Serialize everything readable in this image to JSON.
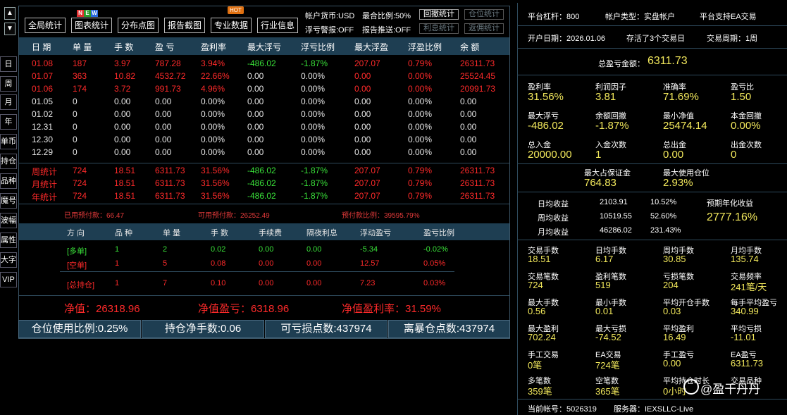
{
  "rail": {
    "up": "▲",
    "down": "▼",
    "items": [
      "日",
      "周",
      "月",
      "年",
      "单币",
      "持仓",
      "品种",
      "魔号",
      "波幅",
      "属性",
      "大字",
      "VIP"
    ]
  },
  "toolbar": {
    "buttons": [
      "全局统计",
      "图表统计",
      "分布点图",
      "报告截图",
      "专业数据",
      "行业信息"
    ],
    "new_badge": [
      "N",
      "E",
      "W"
    ],
    "hot_badge": "HOT",
    "currency": "帐户货币:USD",
    "max_ratio": "最合比例:50%",
    "float_alarm": "浮亏警报:OFF",
    "report_push": "报告推送:OFF",
    "small_buttons": [
      "回撤统计",
      "仓位统计",
      "利息统计",
      "返佣统计"
    ]
  },
  "table": {
    "headers": [
      "日 期",
      "单 量",
      "手 数",
      "盈 亏",
      "盈利率",
      "最大浮亏",
      "浮亏比例",
      "最大浮盈",
      "浮盈比例",
      "余 额"
    ],
    "rows": [
      [
        "01.08",
        "187",
        "3.97",
        "787.28",
        "3.94%",
        "-486.02",
        "-1.87%",
        "207.07",
        "0.79%",
        "26311.73"
      ],
      [
        "01.07",
        "363",
        "10.82",
        "4532.72",
        "22.66%",
        "0.00",
        "0.00%",
        "0.00",
        "0.00%",
        "25524.45"
      ],
      [
        "01.06",
        "174",
        "3.72",
        "991.73",
        "4.96%",
        "0.00",
        "0.00%",
        "0.00",
        "0.00%",
        "20991.73"
      ],
      [
        "01.05",
        "0",
        "0.00",
        "0.00",
        "0.00%",
        "0.00",
        "0.00%",
        "0.00",
        "0.00%",
        "0.00"
      ],
      [
        "01.02",
        "0",
        "0.00",
        "0.00",
        "0.00%",
        "0.00",
        "0.00%",
        "0.00",
        "0.00%",
        "0.00"
      ],
      [
        "12.31",
        "0",
        "0.00",
        "0.00",
        "0.00%",
        "0.00",
        "0.00%",
        "0.00",
        "0.00%",
        "0.00"
      ],
      [
        "12.30",
        "0",
        "0.00",
        "0.00",
        "0.00%",
        "0.00",
        "0.00%",
        "0.00",
        "0.00%",
        "0.00"
      ],
      [
        "12.29",
        "0",
        "0.00",
        "0.00",
        "0.00%",
        "0.00",
        "0.00%",
        "0.00",
        "0.00%",
        "0.00"
      ]
    ],
    "summary": [
      [
        "周统计",
        "724",
        "18.51",
        "6311.73",
        "31.56%",
        "-486.02",
        "-1.87%",
        "207.07",
        "0.79%",
        "26311.73"
      ],
      [
        "月统计",
        "724",
        "18.51",
        "6311.73",
        "31.56%",
        "-486.02",
        "-1.87%",
        "207.07",
        "0.79%",
        "26311.73"
      ],
      [
        "年统计",
        "724",
        "18.51",
        "6311.73",
        "31.56%",
        "-486.02",
        "-1.87%",
        "207.07",
        "0.79%",
        "26311.73"
      ]
    ]
  },
  "prepay": {
    "used": "已用预付款：66.47",
    "available": "可用预付款：26252.49",
    "ratio": "预付款比例：39595.79%"
  },
  "positions": {
    "headers": [
      "方 向",
      "品 种",
      "单 量",
      "手 数",
      "手续费",
      "隔夜利息",
      "浮动盈亏",
      "盈亏比例"
    ],
    "rows": [
      [
        "[多单]",
        "1",
        "2",
        "0.02",
        "0.00",
        "0.00",
        "-5.34",
        "-0.02%"
      ],
      [
        "[空单]",
        "1",
        "5",
        "0.08",
        "0.00",
        "0.00",
        "12.57",
        "0.05%"
      ],
      [
        "[总持仓]",
        "1",
        "7",
        "0.10",
        "0.00",
        "0.00",
        "7.23",
        "0.03%"
      ]
    ]
  },
  "net": {
    "value": "净值：26318.96",
    "profit": "净值盈亏：6318.96",
    "rate": "净值盈利率：31.59%"
  },
  "bottom": [
    "仓位使用比例:0.25%",
    "持仓净手数:0.06",
    "可亏损点数:437974",
    "离暴仓点数:437974"
  ],
  "right": {
    "leverage": "平台杠杆：800",
    "account_type": "帐户类型：实盘帐户",
    "ea_support": "平台支持EA交易",
    "open_date": "开户日期：2026.01.06",
    "alive": "存活了3个交易日",
    "period": "交易周期：1周",
    "total_label": "总盈亏金额：",
    "total_value": "6311.73",
    "grid1": [
      [
        "盈利率",
        "31.56%"
      ],
      [
        "利润因子",
        "3.81"
      ],
      [
        "准确率",
        "71.69%"
      ],
      [
        "盈亏比",
        "1.50"
      ],
      [
        "最大浮亏",
        "-486.02"
      ],
      [
        "余额回撤",
        "-1.87%"
      ],
      [
        "最小净值",
        "25474.14"
      ],
      [
        "本金回撤",
        "0.00%"
      ],
      [
        "总入金",
        "20000.00"
      ],
      [
        "入金次数",
        "1"
      ],
      [
        "总出金",
        "0.00"
      ],
      [
        "出金次数",
        "0"
      ]
    ],
    "margin_label": "最大占保证金",
    "margin_value": "764.83",
    "pos_label": "最大使用仓位",
    "pos_value": "2.93%",
    "income": [
      [
        "日均收益",
        "2103.91",
        "10.52%"
      ],
      [
        "周均收益",
        "10519.55",
        "52.60%"
      ],
      [
        "月均收益",
        "46286.02",
        "231.43%"
      ]
    ],
    "annual_label": "预期年化收益",
    "annual_value": "2777.16%",
    "grid2": [
      [
        "交易手数",
        "18.51"
      ],
      [
        "日均手数",
        "6.17"
      ],
      [
        "周均手数",
        "30.85"
      ],
      [
        "月均手数",
        "135.74"
      ],
      [
        "交易笔数",
        "724"
      ],
      [
        "盈利笔数",
        "519"
      ],
      [
        "亏损笔数",
        "204"
      ],
      [
        "交易频率",
        "241笔/天"
      ],
      [
        "最大手数",
        "0.56"
      ],
      [
        "最小手数",
        "0.01"
      ],
      [
        "平均开仓手数",
        "0.03"
      ],
      [
        "每手平均盈亏",
        "340.99"
      ],
      [
        "最大盈利",
        "702.24"
      ],
      [
        "最大亏损",
        "-74.52"
      ],
      [
        "平均盈利",
        "16.49"
      ],
      [
        "平均亏损",
        "-11.01"
      ],
      [
        "手工交易",
        "0笔"
      ],
      [
        "EA交易",
        "724笔"
      ],
      [
        "手工盈亏",
        "0.00"
      ],
      [
        "EA盈亏",
        "6311.73"
      ],
      [
        "多笔数",
        "359笔"
      ],
      [
        "空笔数",
        "365笔"
      ],
      [
        "平均持仓时长",
        "0小时"
      ],
      [
        "交易品种",
        ""
      ]
    ],
    "account": "当前帐号：5026319",
    "server": "服务器：IEXSLLC-Live"
  },
  "watermark": "@盈干丹丹"
}
